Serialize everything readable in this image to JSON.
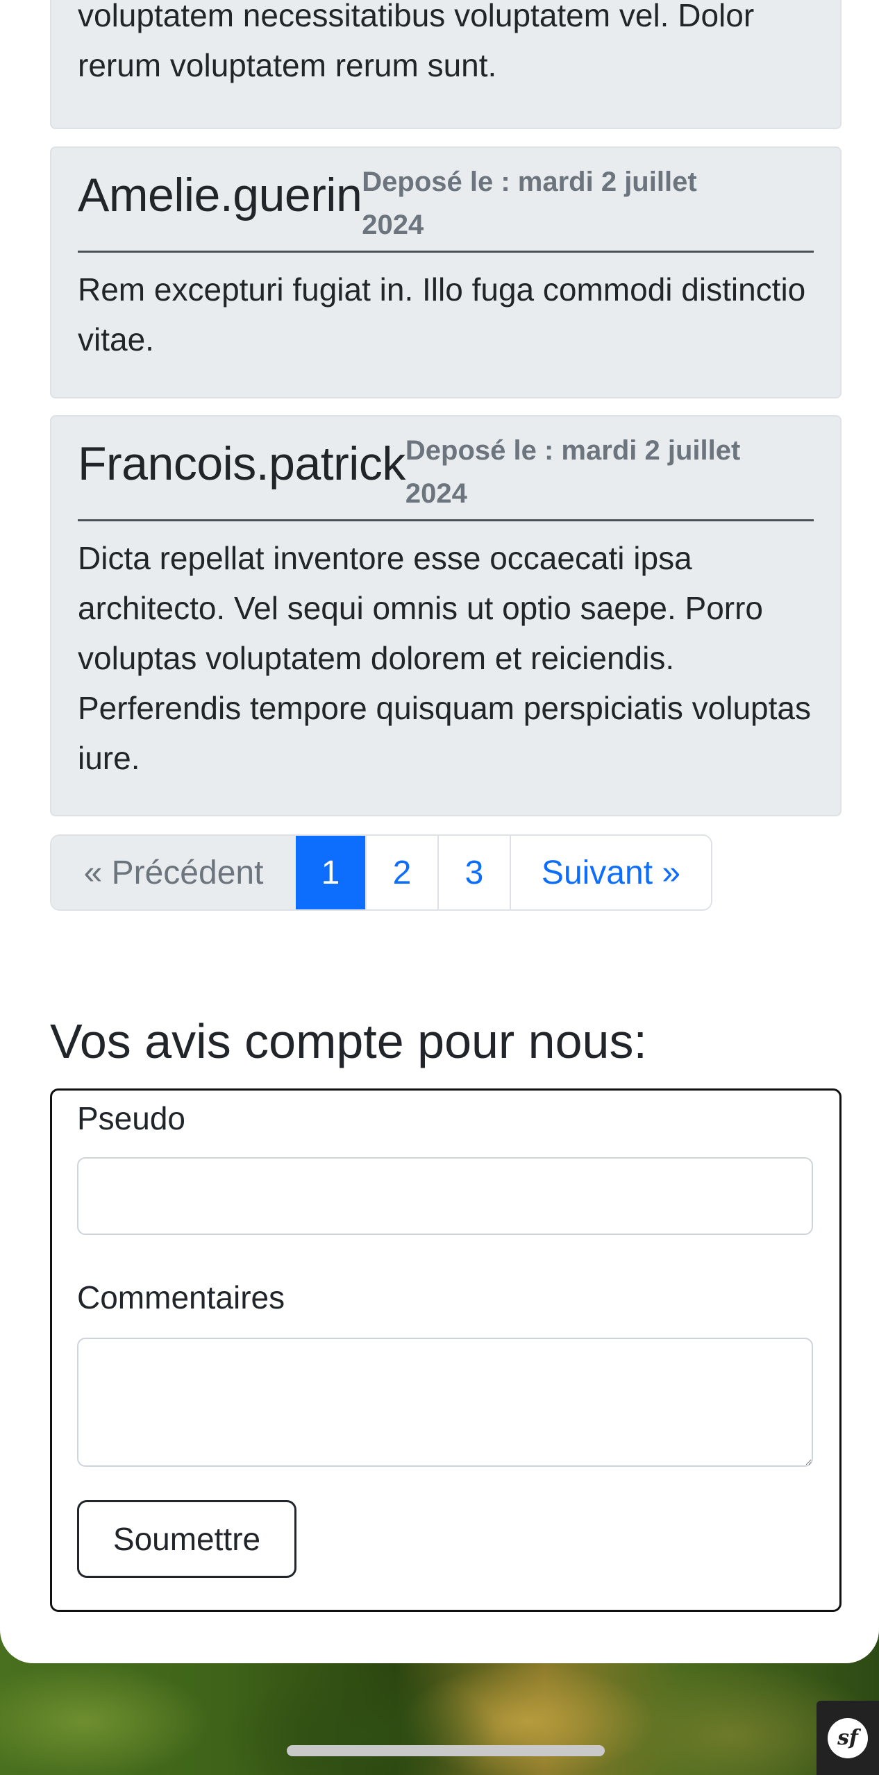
{
  "comments": [
    {
      "author": "",
      "date": "",
      "text": "voluptatem necessitatibus voluptatem vel. Dolor rerum voluptatem rerum sunt."
    },
    {
      "author": "Amelie.guerin",
      "date": "Deposé le : mardi 2 juillet 2024",
      "text": "Rem excepturi fugiat in. Illo fuga commodi distinctio vitae."
    },
    {
      "author": "Francois.patrick",
      "date": "Deposé le : mardi 2 juillet 2024",
      "text": "Dicta repellat inventore esse occaecati ipsa architecto. Vel sequi omnis ut optio saepe. Porro voluptas voluptatem dolorem et reiciendis. Perferendis tempore quisquam perspiciatis voluptas iure."
    }
  ],
  "pagination": {
    "prev_label": "« Précédent",
    "pages": [
      "1",
      "2",
      "3"
    ],
    "current_page": "1",
    "next_label": "Suivant »"
  },
  "feedback_form": {
    "title": "Vos avis compte pour nous:",
    "pseudo_label": "Pseudo",
    "pseudo_value": "",
    "comment_label": "Commentaires",
    "comment_value": "",
    "submit_label": "Soumettre"
  },
  "badges": {
    "symfony_logo": "sf"
  },
  "icons": {
    "symfony": "symfony-icon"
  },
  "colors": {
    "primary": "#0d6efd",
    "card_background": "#e9ecef",
    "muted_text": "#6c757d"
  }
}
